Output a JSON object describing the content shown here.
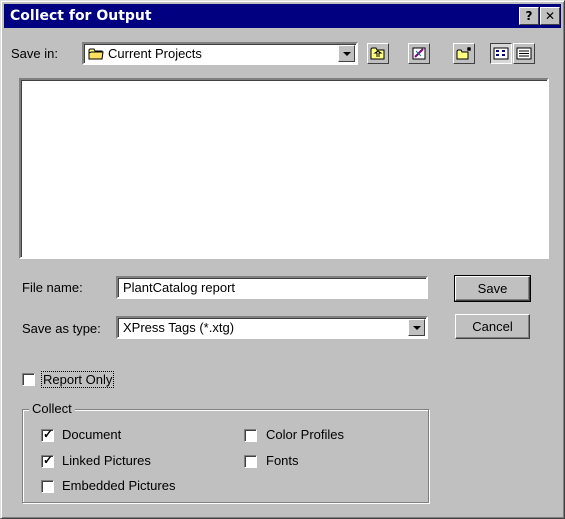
{
  "window": {
    "title": "Collect for Output",
    "help_label": "?",
    "close_label": "✕"
  },
  "save_in": {
    "label": "Save in:",
    "value": "Current Projects"
  },
  "file_name": {
    "label": "File name:",
    "value": "PlantCatalog report"
  },
  "save_as_type": {
    "label": "Save as type:",
    "value": "XPress Tags (*.xtg)"
  },
  "buttons": {
    "save": "Save",
    "cancel": "Cancel"
  },
  "report_only": {
    "label": "Report Only",
    "checked": false
  },
  "collect": {
    "title": "Collect",
    "options": [
      {
        "label": "Document",
        "checked": true
      },
      {
        "label": "Linked Pictures",
        "checked": true
      },
      {
        "label": "Embedded Pictures",
        "checked": false
      },
      {
        "label": "Color Profiles",
        "checked": false
      },
      {
        "label": "Fonts",
        "checked": false
      }
    ]
  },
  "toolbar_icons": [
    "up-one-level-icon",
    "desktop-icon",
    "new-folder-icon",
    "list-view-icon",
    "details-view-icon"
  ]
}
